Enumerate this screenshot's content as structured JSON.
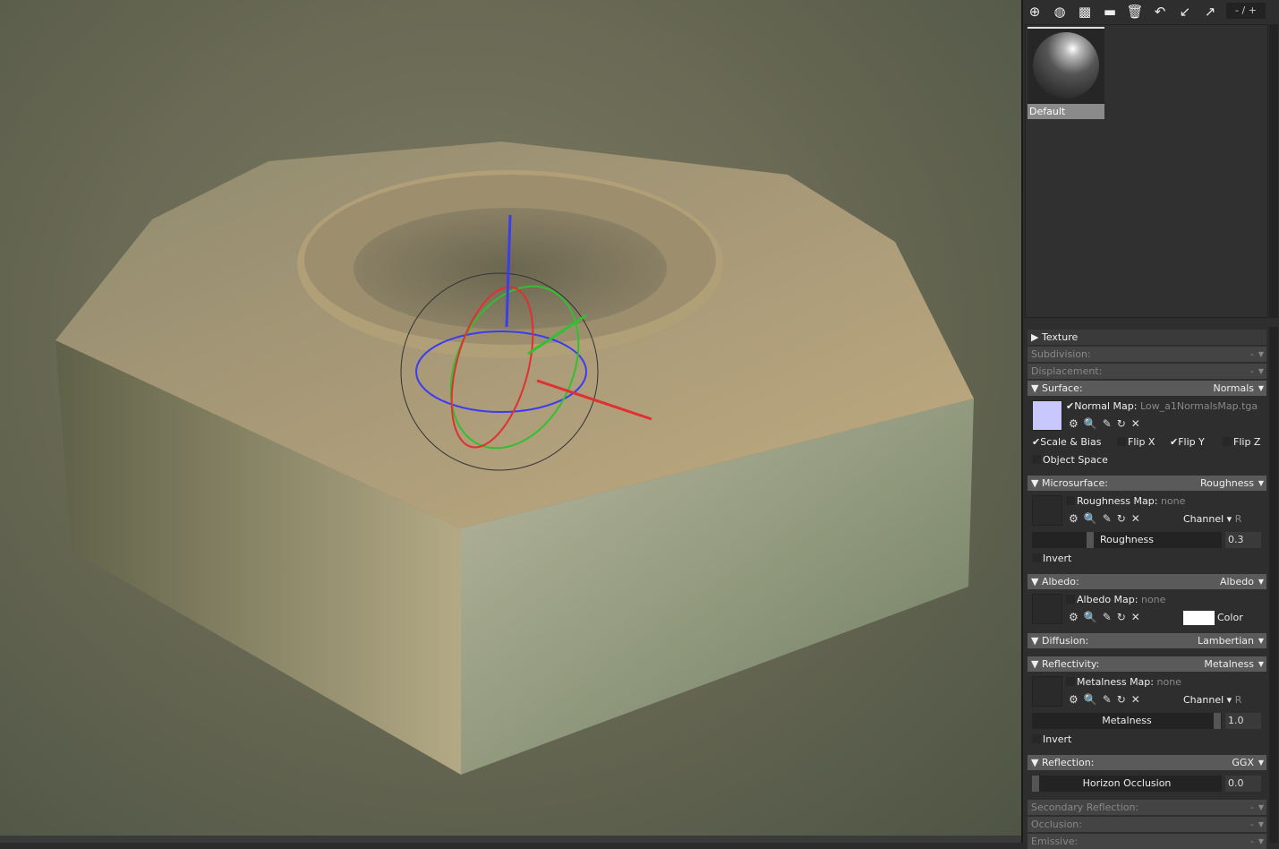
{
  "toolbar": {
    "icons": [
      "add-material-icon",
      "duplicate-icon",
      "checker-icon",
      "folder-icon",
      "trash-icon",
      "import-icon",
      "export-in-icon",
      "export-out-icon"
    ],
    "pager": "- / +"
  },
  "materials": [
    {
      "name": "Default"
    }
  ],
  "sections": {
    "texture": "Texture",
    "subdivision": {
      "label": "Subdivision:",
      "value": "-"
    },
    "displacement": {
      "label": "Displacement:",
      "value": "-"
    },
    "surface": {
      "label": "Surface:",
      "value": "Normals",
      "map_label": "Normal Map:",
      "map_file": "Low_a1NormalsMap.tga",
      "map_color": "#c8c8ff",
      "scale_bias": "Scale & Bias",
      "flip_x": "Flip X",
      "flip_y": "Flip Y",
      "flip_z": "Flip Z",
      "object_space": "Object Space"
    },
    "microsurface": {
      "label": "Microsurface:",
      "value": "Roughness",
      "map_label": "Roughness Map:",
      "map_file": "none",
      "channel": "Channel",
      "channel_value": "R",
      "slider_label": "Roughness",
      "slider_value": "0.3",
      "invert": "Invert"
    },
    "albedo": {
      "label": "Albedo:",
      "value": "Albedo",
      "map_label": "Albedo Map:",
      "map_file": "none",
      "color_label": "Color",
      "color": "#ffffff"
    },
    "diffusion": {
      "label": "Diffusion:",
      "value": "Lambertian"
    },
    "reflectivity": {
      "label": "Reflectivity:",
      "value": "Metalness",
      "map_label": "Metalness Map:",
      "map_file": "none",
      "channel": "Channel",
      "channel_value": "R",
      "slider_label": "Metalness",
      "slider_value": "1.0",
      "invert": "Invert"
    },
    "reflection": {
      "label": "Reflection:",
      "value": "GGX",
      "slider_label": "Horizon Occlusion",
      "slider_value": "0.0"
    },
    "secondary_reflection": {
      "label": "Secondary Reflection:",
      "value": "-"
    },
    "occlusion": {
      "label": "Occlusion:",
      "value": "-"
    },
    "emissive": {
      "label": "Emissive:",
      "value": "-"
    }
  },
  "map_tool_icons": "⚙🔍✎↻✕"
}
